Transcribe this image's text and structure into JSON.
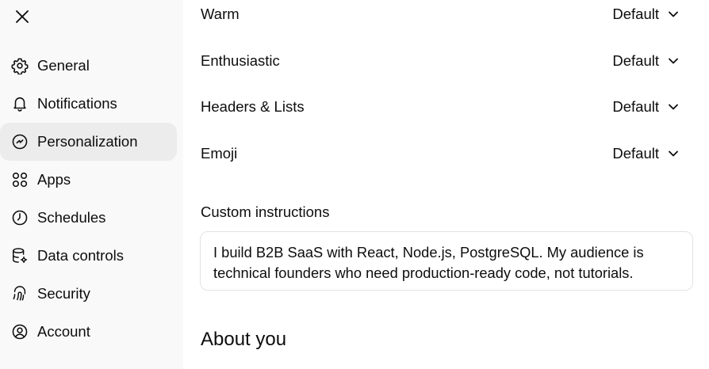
{
  "sidebar": {
    "close_label": "Close",
    "items": [
      {
        "label": "General",
        "icon": "gear-icon",
        "active": false
      },
      {
        "label": "Notifications",
        "icon": "bell-icon",
        "active": false
      },
      {
        "label": "Personalization",
        "icon": "personalization-icon",
        "active": true
      },
      {
        "label": "Apps",
        "icon": "apps-grid-icon",
        "active": false
      },
      {
        "label": "Schedules",
        "icon": "clock-icon",
        "active": false
      },
      {
        "label": "Data controls",
        "icon": "database-gear-icon",
        "active": false
      },
      {
        "label": "Security",
        "icon": "fingerprint-icon",
        "active": false
      },
      {
        "label": "Account",
        "icon": "user-circle-icon",
        "active": false
      }
    ]
  },
  "main": {
    "traits": [
      {
        "label": "Warm",
        "value": "Default"
      },
      {
        "label": "Enthusiastic",
        "value": "Default"
      },
      {
        "label": "Headers & Lists",
        "value": "Default"
      },
      {
        "label": "Emoji",
        "value": "Default"
      }
    ],
    "custom_instructions": {
      "label": "Custom instructions",
      "value_line1": "I build B2B SaaS with React, Node.js, PostgreSQL. My audience is",
      "value_line2": "technical founders who need production-ready code, not tutorials."
    },
    "about_heading": "About you"
  },
  "colors": {
    "sidebar_bg": "#f9f9f9",
    "active_item_bg": "#ececec",
    "text": "#0d0d0d",
    "border": "#e3e3e3"
  }
}
